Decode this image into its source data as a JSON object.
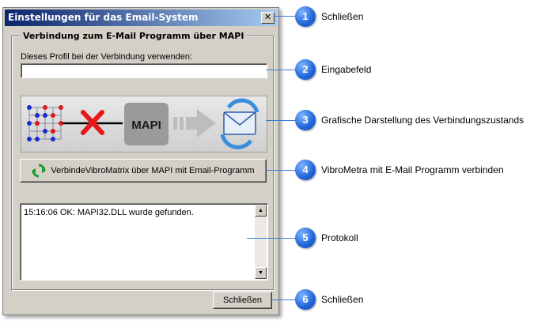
{
  "window": {
    "title": "Einstellungen für das Email-System",
    "close_glyph": "✕"
  },
  "group": {
    "title": "Verbindung zum E-Mail Programm über MAPI",
    "profile_label": "Dieses Profil bei der Verbindung verwenden:",
    "profile_value": ""
  },
  "graphic": {
    "mapi_label": "MAPI",
    "status": "disconnected"
  },
  "connect_button": {
    "label": "VerbindeVibroMatrix über MAPI mit Email-Programm"
  },
  "log": {
    "lines": [
      "15:16:06 OK: MAPI32.DLL wurde gefunden."
    ]
  },
  "close_button": {
    "label": "Schließen"
  },
  "callouts": [
    {
      "num": "1",
      "text": "Schließen"
    },
    {
      "num": "2",
      "text": "Eingabefeld"
    },
    {
      "num": "3",
      "text": "Grafische Darstellung des Verbindungszustands"
    },
    {
      "num": "4",
      "text": "VibroMetra mit E-Mail Programm verbinden"
    },
    {
      "num": "5",
      "text": "Protokoll"
    },
    {
      "num": "6",
      "text": "Schließen"
    }
  ],
  "colors": {
    "callout_blue": "#1f64d8",
    "titlebar_start": "#0a246a",
    "titlebar_end": "#a6caf0",
    "disconnect_red": "#e81818"
  }
}
